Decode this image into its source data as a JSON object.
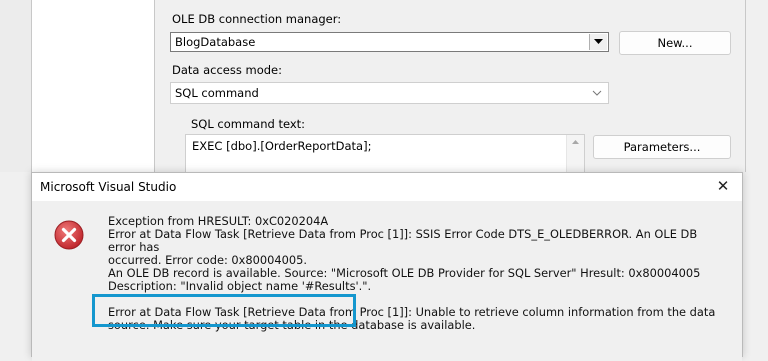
{
  "editor": {
    "connection_label": "OLE DB connection manager:",
    "connection_value": "BlogDatabase",
    "new_button": "New...",
    "access_mode_label": "Data access mode:",
    "access_mode_value": "SQL command",
    "sql_label": "SQL command text:",
    "sql_text": "EXEC [dbo].[OrderReportData];",
    "parameters_button": "Parameters..."
  },
  "dialog": {
    "title": "Microsoft Visual Studio",
    "close_glyph": "✕",
    "lines": [
      "Exception from HRESULT: 0xC020204A",
      "Error at Data Flow Task [Retrieve Data from Proc [1]]: SSIS Error Code DTS_E_OLEDBERROR.  An OLE DB error has",
      "occurred. Error code: 0x80004005.",
      "An OLE DB record is available.  Source: \"Microsoft OLE DB Provider for SQL Server\"  Hresult: 0x80004005",
      "Description: \"Invalid object name '#Results'.\".",
      "",
      "Error at Data Flow Task [Retrieve Data from Proc [1]]: Unable to retrieve column information from the data",
      "source. Make sure your target table in the database is available."
    ],
    "highlight_color": "#1497ce",
    "error_icon_color": "#d43b3b"
  }
}
